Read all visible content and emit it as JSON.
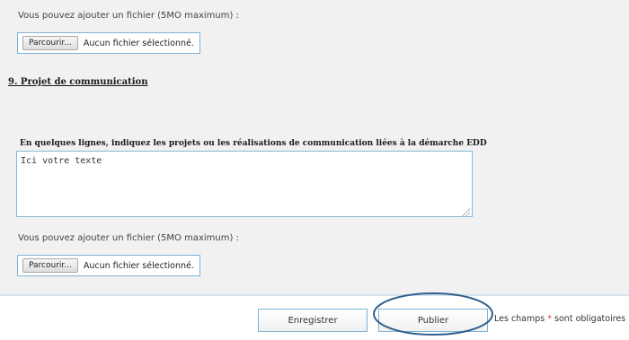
{
  "upload_top": {
    "hint": "Vous pouvez ajouter un fichier (5MO maximum) :",
    "browse_label": "Parcourir...",
    "status": "Aucun fichier sélectionné."
  },
  "section": {
    "title": "9.  Projet de communication"
  },
  "question": {
    "label": "En quelques lignes, indiquez les projets ou les réalisations de communication liées à la démarche EDD",
    "textarea_value": "Ici votre texte"
  },
  "upload_bottom": {
    "hint": "Vous pouvez ajouter un fichier (5MO maximum) :",
    "browse_label": "Parcourir...",
    "status": "Aucun fichier sélectionné."
  },
  "actions": {
    "save_label": "Enregistrer",
    "publish_label": "Publier"
  },
  "required_note": {
    "prefix": "Les champs ",
    "star": "*",
    "suffix": " sont obligatoires"
  },
  "colors": {
    "panel_bg": "#f1f1f1",
    "field_border": "#7fb2d3",
    "required_star": "#e04040",
    "annotation_ellipse": "#2f5f8f"
  }
}
